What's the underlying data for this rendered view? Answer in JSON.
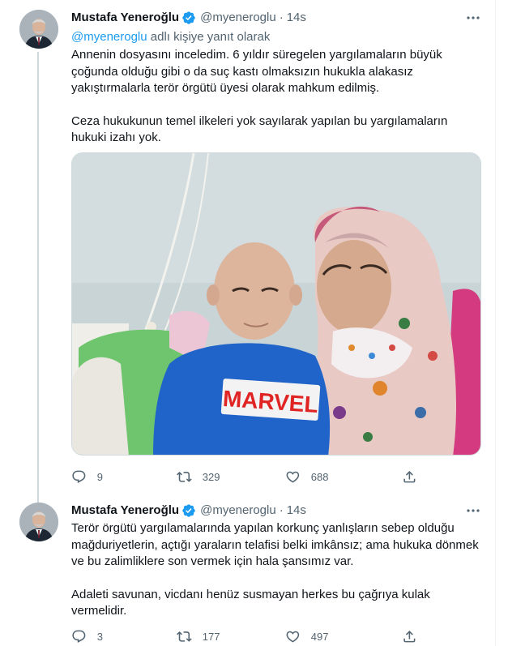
{
  "colors": {
    "accent": "#1d9bf0",
    "text_primary": "#0f1419",
    "text_secondary": "#536471",
    "divider": "#eff3f4"
  },
  "tweets": [
    {
      "author_name": "Mustafa Yeneroğlu",
      "handle": "@myeneroglu",
      "dot": "·",
      "time": "14s",
      "verified_icon": "verified-badge-icon",
      "reply_prefix": "@myeneroglu",
      "reply_suffix": " adlı kişiye yanıt olarak",
      "paragraphs": [
        "Annenin dosyasını inceledim. 6 yıldır süregelen yargılamaların büyük çoğunda olduğu gibi o da suç kastı olmaksızın hukukla alakasız yakıştırmalarla terör örgütü üyesi olarak mahkum edilmiş.",
        "Ceza hukukunun temel ilkeleri yok sayılarak yapılan bu yargılamaların hukuki izahı yok."
      ],
      "photo": {
        "shirt_text": "MARVEL"
      },
      "actions": {
        "replies": "9",
        "retweets": "329",
        "likes": "688"
      }
    },
    {
      "author_name": "Mustafa Yeneroğlu",
      "handle": "@myeneroglu",
      "dot": "·",
      "time": "14s",
      "verified_icon": "verified-badge-icon",
      "paragraphs": [
        "Terör örgütü yargılamalarında yapılan korkunç yanlışların sebep olduğu mağduriyetlerin, açtığı yaraların telafisi belki imkânsız; ama hukuka dönmek ve bu zalimliklere son vermek için hala şansımız var.",
        "Adaleti savunan, vicdanı henüz susmayan herkes bu çağrıya kulak vermelidir."
      ],
      "actions": {
        "replies": "3",
        "retweets": "177",
        "likes": "497"
      }
    }
  ]
}
